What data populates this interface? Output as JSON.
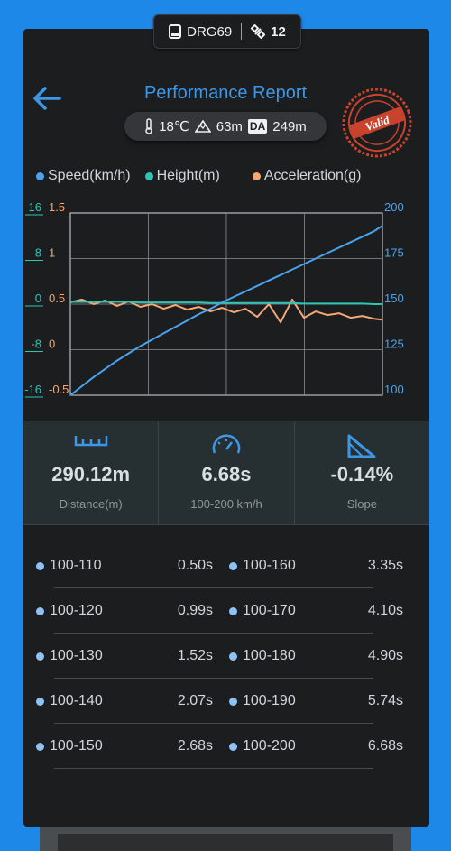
{
  "topbar": {
    "device_name": "DRG69",
    "satellite_count": "12"
  },
  "header": {
    "title": "Performance Report",
    "temperature": "18℃",
    "altitude": "63m",
    "density_altitude_badge": "DA",
    "density_altitude": "249m",
    "stamp_text": "Valid"
  },
  "legend": [
    {
      "label": "Speed(km/h)",
      "color": "#4aa3f0"
    },
    {
      "label": "Height(m)",
      "color": "#2ec4b6"
    },
    {
      "label": "Acceleration(g)",
      "color": "#f5a874"
    }
  ],
  "chart_data": {
    "type": "line",
    "x": [
      0,
      0.25,
      0.5,
      0.75,
      1,
      1.25,
      1.5,
      1.75,
      2,
      2.25,
      2.5,
      2.75,
      3,
      3.25,
      3.5,
      3.75,
      4,
      4.25,
      4.5,
      4.75,
      5,
      5.25,
      5.5,
      5.75,
      6,
      6.25,
      6.5,
      6.68
    ],
    "axes": {
      "height_left": {
        "ticks": [
          "16",
          "8",
          "0",
          "-8",
          "-16"
        ],
        "ylim": [
          -16,
          16
        ],
        "color": "#2ec4b6"
      },
      "acceleration_left": {
        "ticks": [
          "1.5",
          "1",
          "0.5",
          "0",
          "-0.5"
        ],
        "ylim": [
          -0.5,
          1.5
        ],
        "color": "#f5a874"
      },
      "speed_right": {
        "ticks": [
          "200",
          "175",
          "150",
          "125",
          "100"
        ],
        "ylim": [
          100,
          200
        ],
        "color": "#4aa3f0"
      }
    },
    "grid": true,
    "series": [
      {
        "name": "Speed(km/h)",
        "color": "#4aa3f0",
        "values": [
          100,
          105,
          110,
          114.5,
          119,
          123,
          127,
          130.5,
          134,
          137.5,
          141,
          144.5,
          147.5,
          151,
          154,
          157,
          160,
          163,
          166,
          169,
          172,
          175,
          178,
          181,
          184,
          187,
          190,
          193
        ]
      },
      {
        "name": "Height(m)",
        "color": "#2ec4b6",
        "values": [
          0.4,
          0.4,
          0.4,
          0.4,
          0.4,
          0.4,
          0.3,
          0.3,
          0.3,
          0.3,
          0.3,
          0.3,
          0.2,
          0.2,
          0.2,
          0.2,
          0.2,
          0.2,
          0.2,
          0.2,
          0.1,
          0.1,
          0.1,
          0.1,
          0.1,
          0.1,
          0.0,
          0.0
        ]
      },
      {
        "name": "Acceleration(g)",
        "color": "#f5a874",
        "values": [
          0.52,
          0.55,
          0.5,
          0.54,
          0.48,
          0.53,
          0.47,
          0.5,
          0.45,
          0.49,
          0.44,
          0.47,
          0.42,
          0.46,
          0.41,
          0.45,
          0.36,
          0.5,
          0.3,
          0.55,
          0.35,
          0.42,
          0.38,
          0.4,
          0.35,
          0.37,
          0.34,
          0.33
        ]
      }
    ]
  },
  "stats": [
    {
      "icon": "ruler-icon",
      "value": "290.12m",
      "label": "Distance(m)"
    },
    {
      "icon": "speedometer-icon",
      "value": "6.68s",
      "label": "100-200 km/h"
    },
    {
      "icon": "slope-icon",
      "value": "-0.14%",
      "label": "Slope"
    }
  ],
  "splits": [
    {
      "left_label": "100-110",
      "left_time": "0.50s",
      "right_label": "100-160",
      "right_time": "3.35s"
    },
    {
      "left_label": "100-120",
      "left_time": "0.99s",
      "right_label": "100-170",
      "right_time": "4.10s"
    },
    {
      "left_label": "100-130",
      "left_time": "1.52s",
      "right_label": "100-180",
      "right_time": "4.90s"
    },
    {
      "left_label": "100-140",
      "left_time": "2.07s",
      "right_label": "100-190",
      "right_time": "5.74s"
    },
    {
      "left_label": "100-150",
      "left_time": "2.68s",
      "right_label": "100-200",
      "right_time": "6.68s"
    }
  ]
}
